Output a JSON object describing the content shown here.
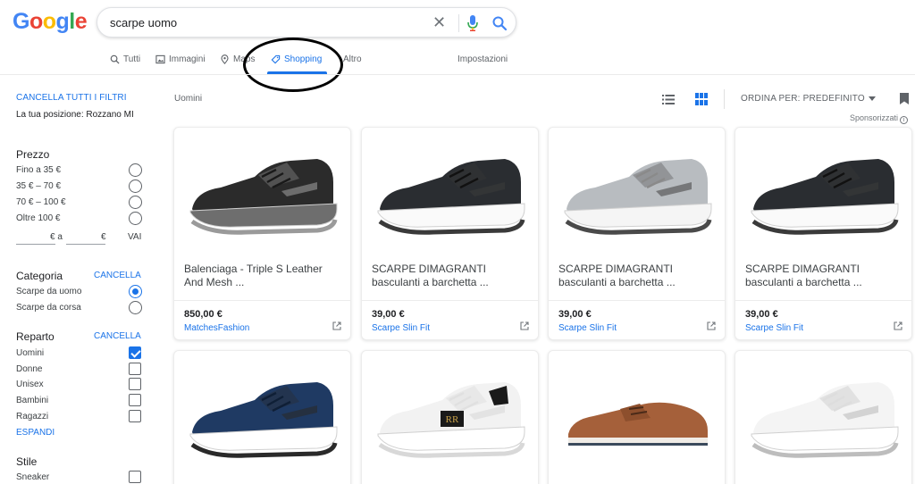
{
  "header": {
    "logo": "Google",
    "logo_colors": [
      "#4285F4",
      "#EA4335",
      "#FBBC05",
      "#4285F4",
      "#34A853",
      "#EA4335"
    ],
    "search_query": "scarpe uomo",
    "icons": {
      "clear": "close-icon",
      "voice": "microphone-icon",
      "search": "search-icon"
    }
  },
  "tabs": [
    {
      "label": "Tutti",
      "icon": "search-icon",
      "active": false
    },
    {
      "label": "Immagini",
      "icon": "image-icon",
      "active": false
    },
    {
      "label": "Maps",
      "icon": "map-pin-icon",
      "active": false
    },
    {
      "label": "Shopping",
      "icon": "tag-icon",
      "active": true
    },
    {
      "label": "Altro",
      "icon": "more-icon",
      "active": false
    },
    {
      "label": "Impostazioni",
      "active": false
    }
  ],
  "sidebar": {
    "clear_all": "CANCELLA TUTTI I FILTRI",
    "location": "La tua posizione: Rozzano MI",
    "price": {
      "title": "Prezzo",
      "options": [
        "Fino a 35 €",
        "35 € – 70 €",
        "70 € – 100 €",
        "Oltre 100 €"
      ],
      "range_sep": "€ a",
      "range_unit": "€",
      "go": "VAI"
    },
    "category": {
      "title": "Categoria",
      "action": "CANCELLA",
      "options": [
        {
          "label": "Scarpe da uomo",
          "selected": true
        },
        {
          "label": "Scarpe da corsa",
          "selected": false
        }
      ]
    },
    "department": {
      "title": "Reparto",
      "action": "CANCELLA",
      "options": [
        {
          "label": "Uomini",
          "checked": true
        },
        {
          "label": "Donne",
          "checked": false
        },
        {
          "label": "Unisex",
          "checked": false
        },
        {
          "label": "Bambini",
          "checked": false
        },
        {
          "label": "Ragazzi",
          "checked": false
        }
      ],
      "expand": "ESPANDI"
    },
    "style": {
      "title": "Stile",
      "options": [
        {
          "label": "Sneaker",
          "checked": false
        }
      ]
    }
  },
  "results": {
    "title": "Uomini",
    "sort_label": "ORDINA PER: PREDEFINITO",
    "sponsored": "Sponsorizzati",
    "products": [
      {
        "title1": "Balenciaga - Triple S Leather",
        "title2": "And Mesh ...",
        "price": "850,00 €",
        "seller": "MatchesFashion",
        "shoe": "balenciaga"
      },
      {
        "title1": "SCARPE DIMAGRANTI",
        "title2": "basculanti a barchetta ...",
        "price": "39,00 €",
        "seller": "Scarpe Slin Fit",
        "shoe": "black"
      },
      {
        "title1": "SCARPE DIMAGRANTI",
        "title2": "basculanti a barchetta ...",
        "price": "39,00 €",
        "seller": "Scarpe Slin Fit",
        "shoe": "grey"
      },
      {
        "title1": "SCARPE DIMAGRANTI",
        "title2": "basculanti a barchetta ...",
        "price": "39,00 €",
        "seller": "Scarpe Slin Fit",
        "shoe": "black"
      },
      {
        "shoe": "navy"
      },
      {
        "shoe": "white-gold"
      },
      {
        "shoe": "brown"
      },
      {
        "shoe": "white"
      }
    ]
  },
  "colors": {
    "accent": "#1a73e8",
    "text": "#202124",
    "muted": "#5f6368"
  }
}
